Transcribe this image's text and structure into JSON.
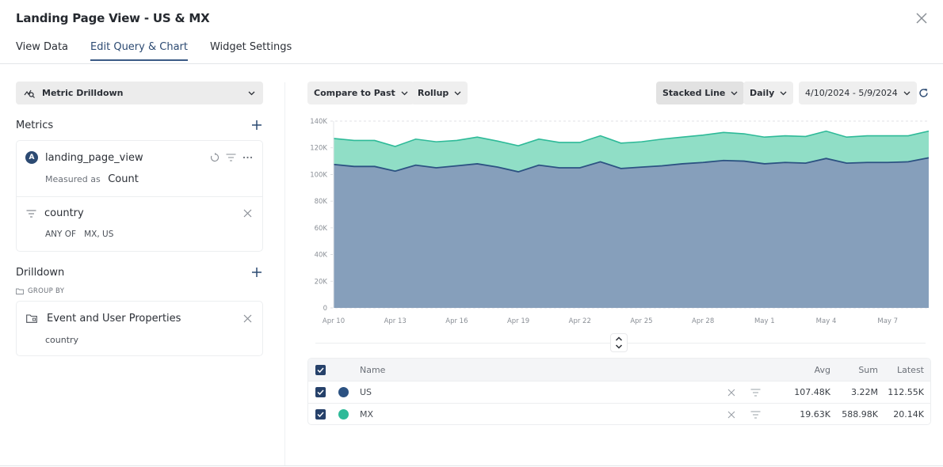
{
  "dialog": {
    "title": "Landing Page View - US & MX",
    "close_icon": "close-icon"
  },
  "tabs": [
    {
      "label": "View Data",
      "active": false
    },
    {
      "label": "Edit Query & Chart",
      "active": true
    },
    {
      "label": "Widget Settings",
      "active": false
    }
  ],
  "left_panel": {
    "chart_type_select": {
      "label": "Metric Drilldown",
      "icon": "metric-drilldown-icon"
    },
    "metrics": {
      "heading": "Metrics",
      "items": [
        {
          "badge": "A",
          "name": "landing_page_view",
          "measured_label": "Measured as",
          "measured_value": "Count",
          "filters": [
            {
              "property": "country",
              "operator": "ANY OF",
              "values": "MX, US"
            }
          ]
        }
      ]
    },
    "drilldown": {
      "heading": "Drilldown",
      "group_by_label": "GROUP BY",
      "groups": [
        {
          "source": "Event and User Properties",
          "property": "country"
        }
      ]
    }
  },
  "controls": {
    "compare": "Compare to Past",
    "rollup": "Rollup",
    "chart_style": "Stacked Line",
    "interval": "Daily",
    "date_range": "4/10/2024 - 5/9/2024"
  },
  "colors": {
    "us": "#2c5282",
    "us_fill": "#869fbb",
    "mx": "#2eba98",
    "mx_fill": "#90dec6",
    "accent": "#2c4a72"
  },
  "chart_data": {
    "type": "area",
    "stacked": true,
    "title": "",
    "xlabel": "",
    "ylabel": "",
    "ylim": [
      0,
      140000
    ],
    "yticks": [
      "0",
      "20K",
      "40K",
      "60K",
      "80K",
      "100K",
      "120K",
      "140K"
    ],
    "ytick_values": [
      0,
      20000,
      40000,
      60000,
      80000,
      100000,
      120000,
      140000
    ],
    "xtick_labels": [
      "Apr 10",
      "Apr 13",
      "Apr 16",
      "Apr 19",
      "Apr 22",
      "Apr 25",
      "Apr 28",
      "May 1",
      "May 4",
      "May 7"
    ],
    "xtick_index": [
      0,
      3,
      6,
      9,
      12,
      15,
      18,
      21,
      24,
      27
    ],
    "grid": true,
    "x": [
      "Apr 10",
      "Apr 11",
      "Apr 12",
      "Apr 13",
      "Apr 14",
      "Apr 15",
      "Apr 16",
      "Apr 17",
      "Apr 18",
      "Apr 19",
      "Apr 20",
      "Apr 21",
      "Apr 22",
      "Apr 23",
      "Apr 24",
      "Apr 25",
      "Apr 26",
      "Apr 27",
      "Apr 28",
      "Apr 29",
      "Apr 30",
      "May 1",
      "May 2",
      "May 3",
      "May 4",
      "May 5",
      "May 6",
      "May 7",
      "May 8",
      "May 9"
    ],
    "series": [
      {
        "name": "US",
        "values": [
          107500,
          106000,
          106000,
          102500,
          107000,
          105000,
          106500,
          108000,
          105500,
          102000,
          107000,
          105000,
          105000,
          109500,
          104500,
          105500,
          106500,
          108000,
          109000,
          110500,
          110000,
          108000,
          109000,
          108500,
          112000,
          108500,
          109000,
          109000,
          109500,
          112500
        ]
      },
      {
        "name": "MX",
        "values": [
          19500,
          19500,
          19500,
          18500,
          19500,
          19500,
          19000,
          20000,
          19500,
          19500,
          19500,
          19000,
          19000,
          19500,
          19000,
          19000,
          20000,
          20000,
          20500,
          21000,
          20500,
          20000,
          20000,
          20000,
          20500,
          19500,
          20000,
          20000,
          19500,
          20000
        ]
      }
    ]
  },
  "table": {
    "columns": [
      "Name",
      "Avg",
      "Sum",
      "Latest"
    ],
    "rows": [
      {
        "name": "US",
        "avg": "107.48K",
        "sum": "3.22M",
        "latest": "112.55K",
        "checked": true
      },
      {
        "name": "MX",
        "avg": "19.63K",
        "sum": "588.98K",
        "latest": "20.14K",
        "checked": true
      }
    ]
  }
}
